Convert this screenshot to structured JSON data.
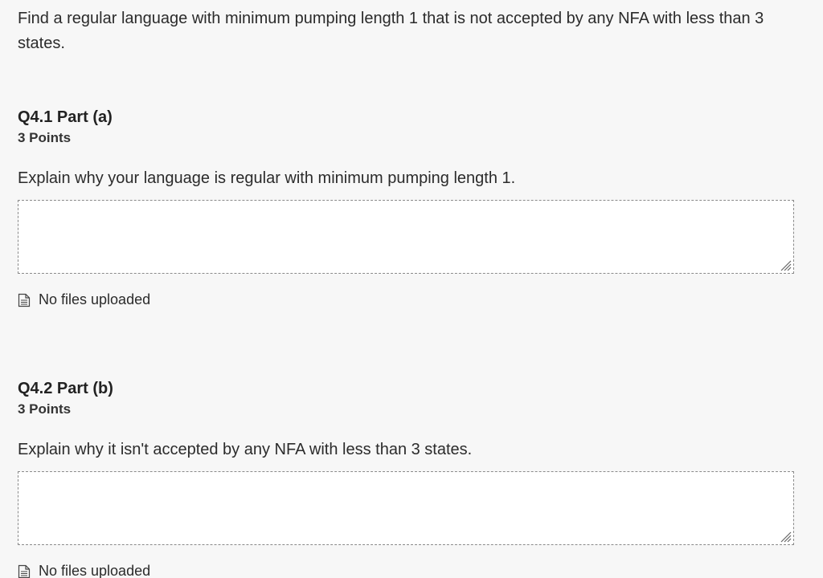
{
  "intro_text": "Find a regular language with minimum pumping length 1 that is not accepted by any NFA with less than 3 states.",
  "questions": [
    {
      "title": "Q4.1 Part (a)",
      "points": "3 Points",
      "prompt": "Explain why your language is regular with minimum pumping length 1.",
      "answer_value": "",
      "files_status": "No files uploaded"
    },
    {
      "title": "Q4.2 Part (b)",
      "points": "3 Points",
      "prompt": "Explain why it isn't accepted by any NFA with less than 3 states.",
      "answer_value": "",
      "files_status": "No files uploaded"
    }
  ],
  "icons": {
    "file": "file-document-icon",
    "resize": "resize-grip-icon"
  },
  "colors": {
    "background": "#f7f7f7",
    "answer_border": "#8a8a8a",
    "text": "#2b2b2b"
  }
}
